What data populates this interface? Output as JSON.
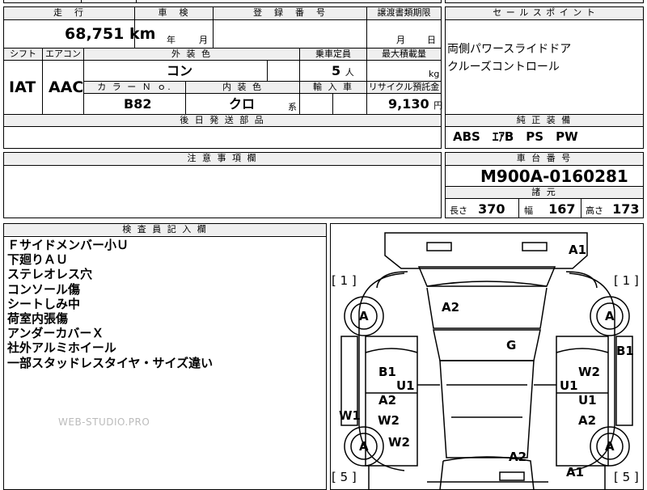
{
  "headers": {
    "mileage": "走　行",
    "inspection": "車　検",
    "registration": "登　録　番　号",
    "transfer_deadline": "譲渡書類期限",
    "sales_points": "セ ー ル ス ポ イ ン ト",
    "shift": "シフト",
    "aircon": "エアコン",
    "ext_color": "外 装 色",
    "capacity": "乗車定員",
    "max_load": "最大積載量",
    "color_no": "カ ラ ー Ｎ ｏ.",
    "int_color": "内 装 色",
    "import": "輸 入 車",
    "recycle": "リサイクル預託金",
    "aftersale_parts": "後 日 発 送 部 品",
    "standard_equipment": "純 正 装 備",
    "notes": "注 意 事 項 欄",
    "chassis_no": "車 台 番 号",
    "specs": "諸 元",
    "inspector_notes": "検 査 員 記 入 欄"
  },
  "values": {
    "mileage": "68,751",
    "mileage_unit": "km",
    "inspection_year_unit": "年",
    "inspection_month_unit": "月",
    "transfer_month_unit": "月",
    "transfer_day_unit": "日",
    "shift": "IAT",
    "aircon": "AAC",
    "ext_color": "コン",
    "capacity": "5",
    "capacity_unit": "人",
    "max_load_unit": "kg",
    "color_no": "B82",
    "int_color": "クロ",
    "int_color_suffix": "系",
    "recycle": "9,130",
    "recycle_unit": "円",
    "equipment": "ABS　ｴｱB　PS　PW",
    "chassis_no": "M900A-0160281",
    "length_label": "長さ",
    "length": "370",
    "width_label": "幅",
    "width": "167",
    "height_label": "高さ",
    "height": "173"
  },
  "sales_points": [
    "両側パワースライドドア",
    "クルーズコントロール"
  ],
  "remarks": [
    "Ｆサイドメンバー小Ｕ",
    "下廻りＡＵ",
    "ステレオレス穴",
    "コンソール傷",
    "シートしみ中",
    "荷室内張傷",
    "アンダーカバーＸ",
    "社外アルミホイール",
    "一部スタッドレスタイヤ・サイズ違い"
  ],
  "diagram": {
    "codes": {
      "a1_top": "A1",
      "a2_top": "A2",
      "g": "G",
      "b1_right": "B1",
      "b1_left": "B1",
      "u1_left": "U1",
      "a2_left": "A2",
      "w2_left": "W2",
      "w1_left": "W1",
      "w2_left_low": "W2",
      "w2_right": "W2",
      "u1_right_a": "U1",
      "u1_right_b": "U1",
      "a2_right": "A2",
      "a2_bottom": "A2",
      "a1_bottom": "A1",
      "tire_fl": "A",
      "tire_fr": "A",
      "tire_rl": "A",
      "tire_rr": "A",
      "tread_fl": "[ 1 ]",
      "tread_fr": "[ 1 ]",
      "tread_rl": "[ 5 ]",
      "tread_rr": "[ 5 ]"
    }
  },
  "watermark": "WEB-STUDIO.PRO"
}
